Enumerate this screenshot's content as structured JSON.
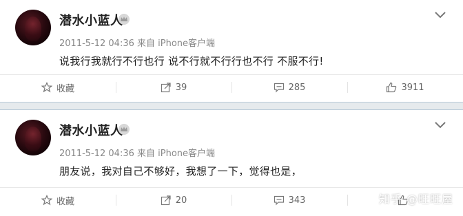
{
  "posts": [
    {
      "username": "潜水小蓝人",
      "meta": "2011-5-12 04:36 来自 iPhone客户端",
      "content": "说我行我就行不行也行 说不行就不行行也不行 不服不行!",
      "actions": {
        "favorite": "收藏",
        "repost": "39",
        "comment": "285",
        "like": "3911"
      }
    },
    {
      "username": "潜水小蓝人",
      "meta": "2011-5-12 04:36 来自 iPhone客户端",
      "content": "朋友说，我对自己不够好，我想了一下，觉得也是，",
      "actions": {
        "favorite": "收藏",
        "repost": "20",
        "comment": "343",
        "like": ""
      }
    }
  ],
  "watermark": "知乎 @旺旺屋",
  "colors": {
    "divider": "#e6eaed",
    "text": "#222222",
    "meta": "#888888",
    "icon": "#777777"
  }
}
